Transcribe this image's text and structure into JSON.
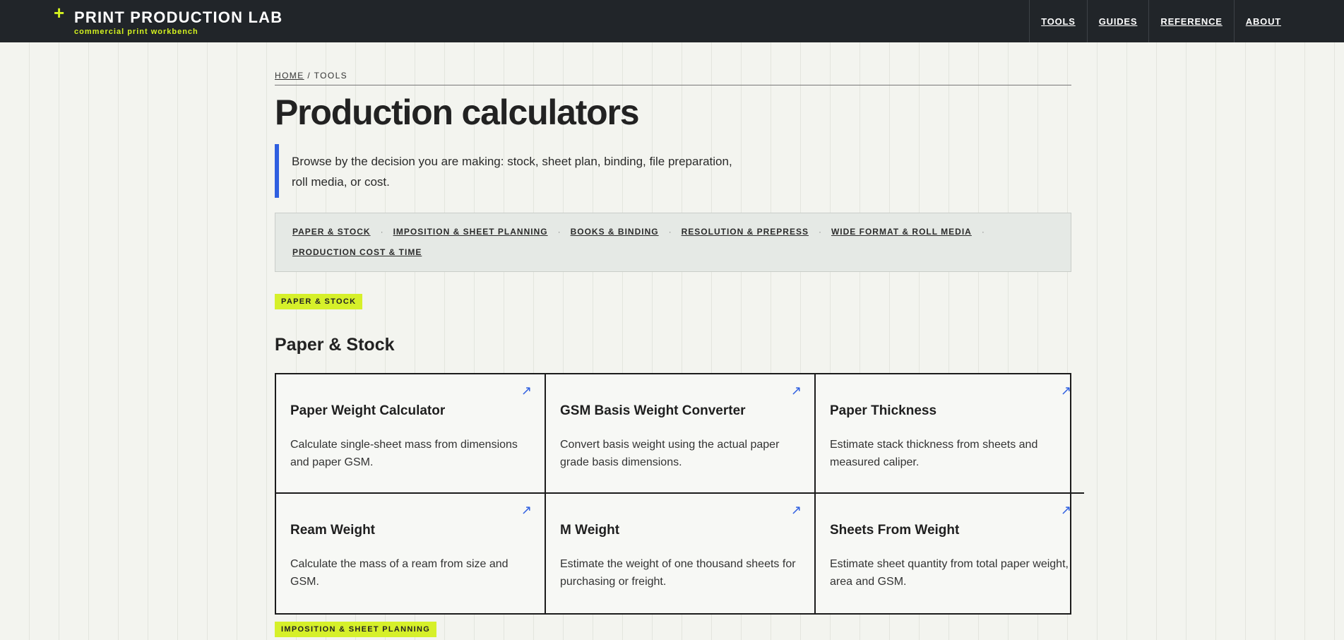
{
  "header": {
    "brand_title": "PRINT PRODUCTION LAB",
    "brand_subtitle": "commercial print workbench",
    "nav": [
      "TOOLS",
      "GUIDES",
      "REFERENCE",
      "ABOUT"
    ]
  },
  "breadcrumb": {
    "home": "HOME",
    "separator": "/",
    "current": "TOOLS"
  },
  "page_title": "Production calculators",
  "intro": "Browse by the decision you are making: stock, sheet plan, binding, file preparation, roll media, or cost.",
  "jump_links": [
    "PAPER & STOCK",
    "IMPOSITION & SHEET PLANNING",
    "BOOKS & BINDING",
    "RESOLUTION & PREPRESS",
    "WIDE FORMAT & ROLL MEDIA",
    "PRODUCTION COST & TIME"
  ],
  "jump_separator": "·",
  "sections": [
    {
      "tag": "PAPER & STOCK",
      "title": "Paper & Stock",
      "cards": [
        {
          "title": "Paper Weight Calculator",
          "desc": "Calculate single-sheet mass from dimensions and paper GSM.",
          "arrow": "↗"
        },
        {
          "title": "GSM Basis Weight Converter",
          "desc": "Convert basis weight using the actual paper grade basis dimensions.",
          "arrow": "↗"
        },
        {
          "title": "Paper Thickness",
          "desc": "Estimate stack thickness from sheets and measured caliper.",
          "arrow": "↗"
        },
        {
          "title": "Ream Weight",
          "desc": "Calculate the mass of a ream from size and GSM.",
          "arrow": "↗"
        },
        {
          "title": "M Weight",
          "desc": "Estimate the weight of one thousand sheets for purchasing or freight.",
          "arrow": "↗"
        },
        {
          "title": "Sheets From Weight",
          "desc": "Estimate sheet quantity from total paper weight, area and GSM.",
          "arrow": "↗"
        }
      ]
    },
    {
      "tag": "IMPOSITION & SHEET PLANNING"
    }
  ],
  "colors": {
    "header_bg": "#212529",
    "accent_lime": "#d4f21f",
    "accent_blue": "#2f5fe0",
    "page_bg": "#f3f4ef"
  }
}
